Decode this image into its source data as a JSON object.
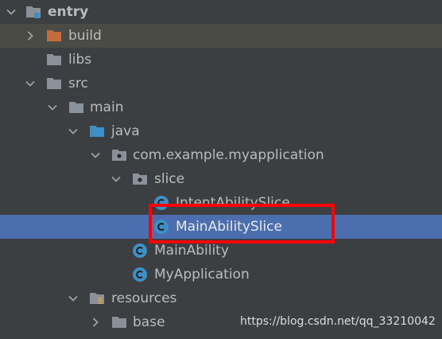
{
  "tree": {
    "items": [
      {
        "label": "entry",
        "icon": "module-folder-icon",
        "expanded": true
      },
      {
        "label": "build",
        "icon": "excluded-folder-icon",
        "expanded": false
      },
      {
        "label": "libs",
        "icon": "folder-icon",
        "expanded": false
      },
      {
        "label": "src",
        "icon": "folder-icon",
        "expanded": true
      },
      {
        "label": "main",
        "icon": "folder-icon",
        "expanded": true
      },
      {
        "label": "java",
        "icon": "source-folder-icon",
        "expanded": true
      },
      {
        "label": "com.example.myapplication",
        "icon": "package-icon",
        "expanded": true
      },
      {
        "label": "slice",
        "icon": "package-icon",
        "expanded": true
      },
      {
        "label": "IntentAbilitySlice",
        "icon": "java-class-icon"
      },
      {
        "label": "MainAbilitySlice",
        "icon": "java-class-icon",
        "selected": true
      },
      {
        "label": "MainAbility",
        "icon": "java-class-icon"
      },
      {
        "label": "MyApplication",
        "icon": "java-class-icon"
      },
      {
        "label": "resources",
        "icon": "resources-folder-icon",
        "expanded": true
      },
      {
        "label": "base",
        "icon": "folder-icon",
        "expanded": false
      }
    ]
  },
  "watermark": {
    "text": "https://blog.csdn.net/qq_33210042"
  },
  "colors": {
    "background": "#3c3f41",
    "selection": "#4b6eaf",
    "highlight_box": "#ff0000",
    "folder": "#8a9199",
    "source_folder": "#3d8fc6",
    "excluded_folder": "#c46b3c",
    "class_icon": "#3d8fc6"
  }
}
